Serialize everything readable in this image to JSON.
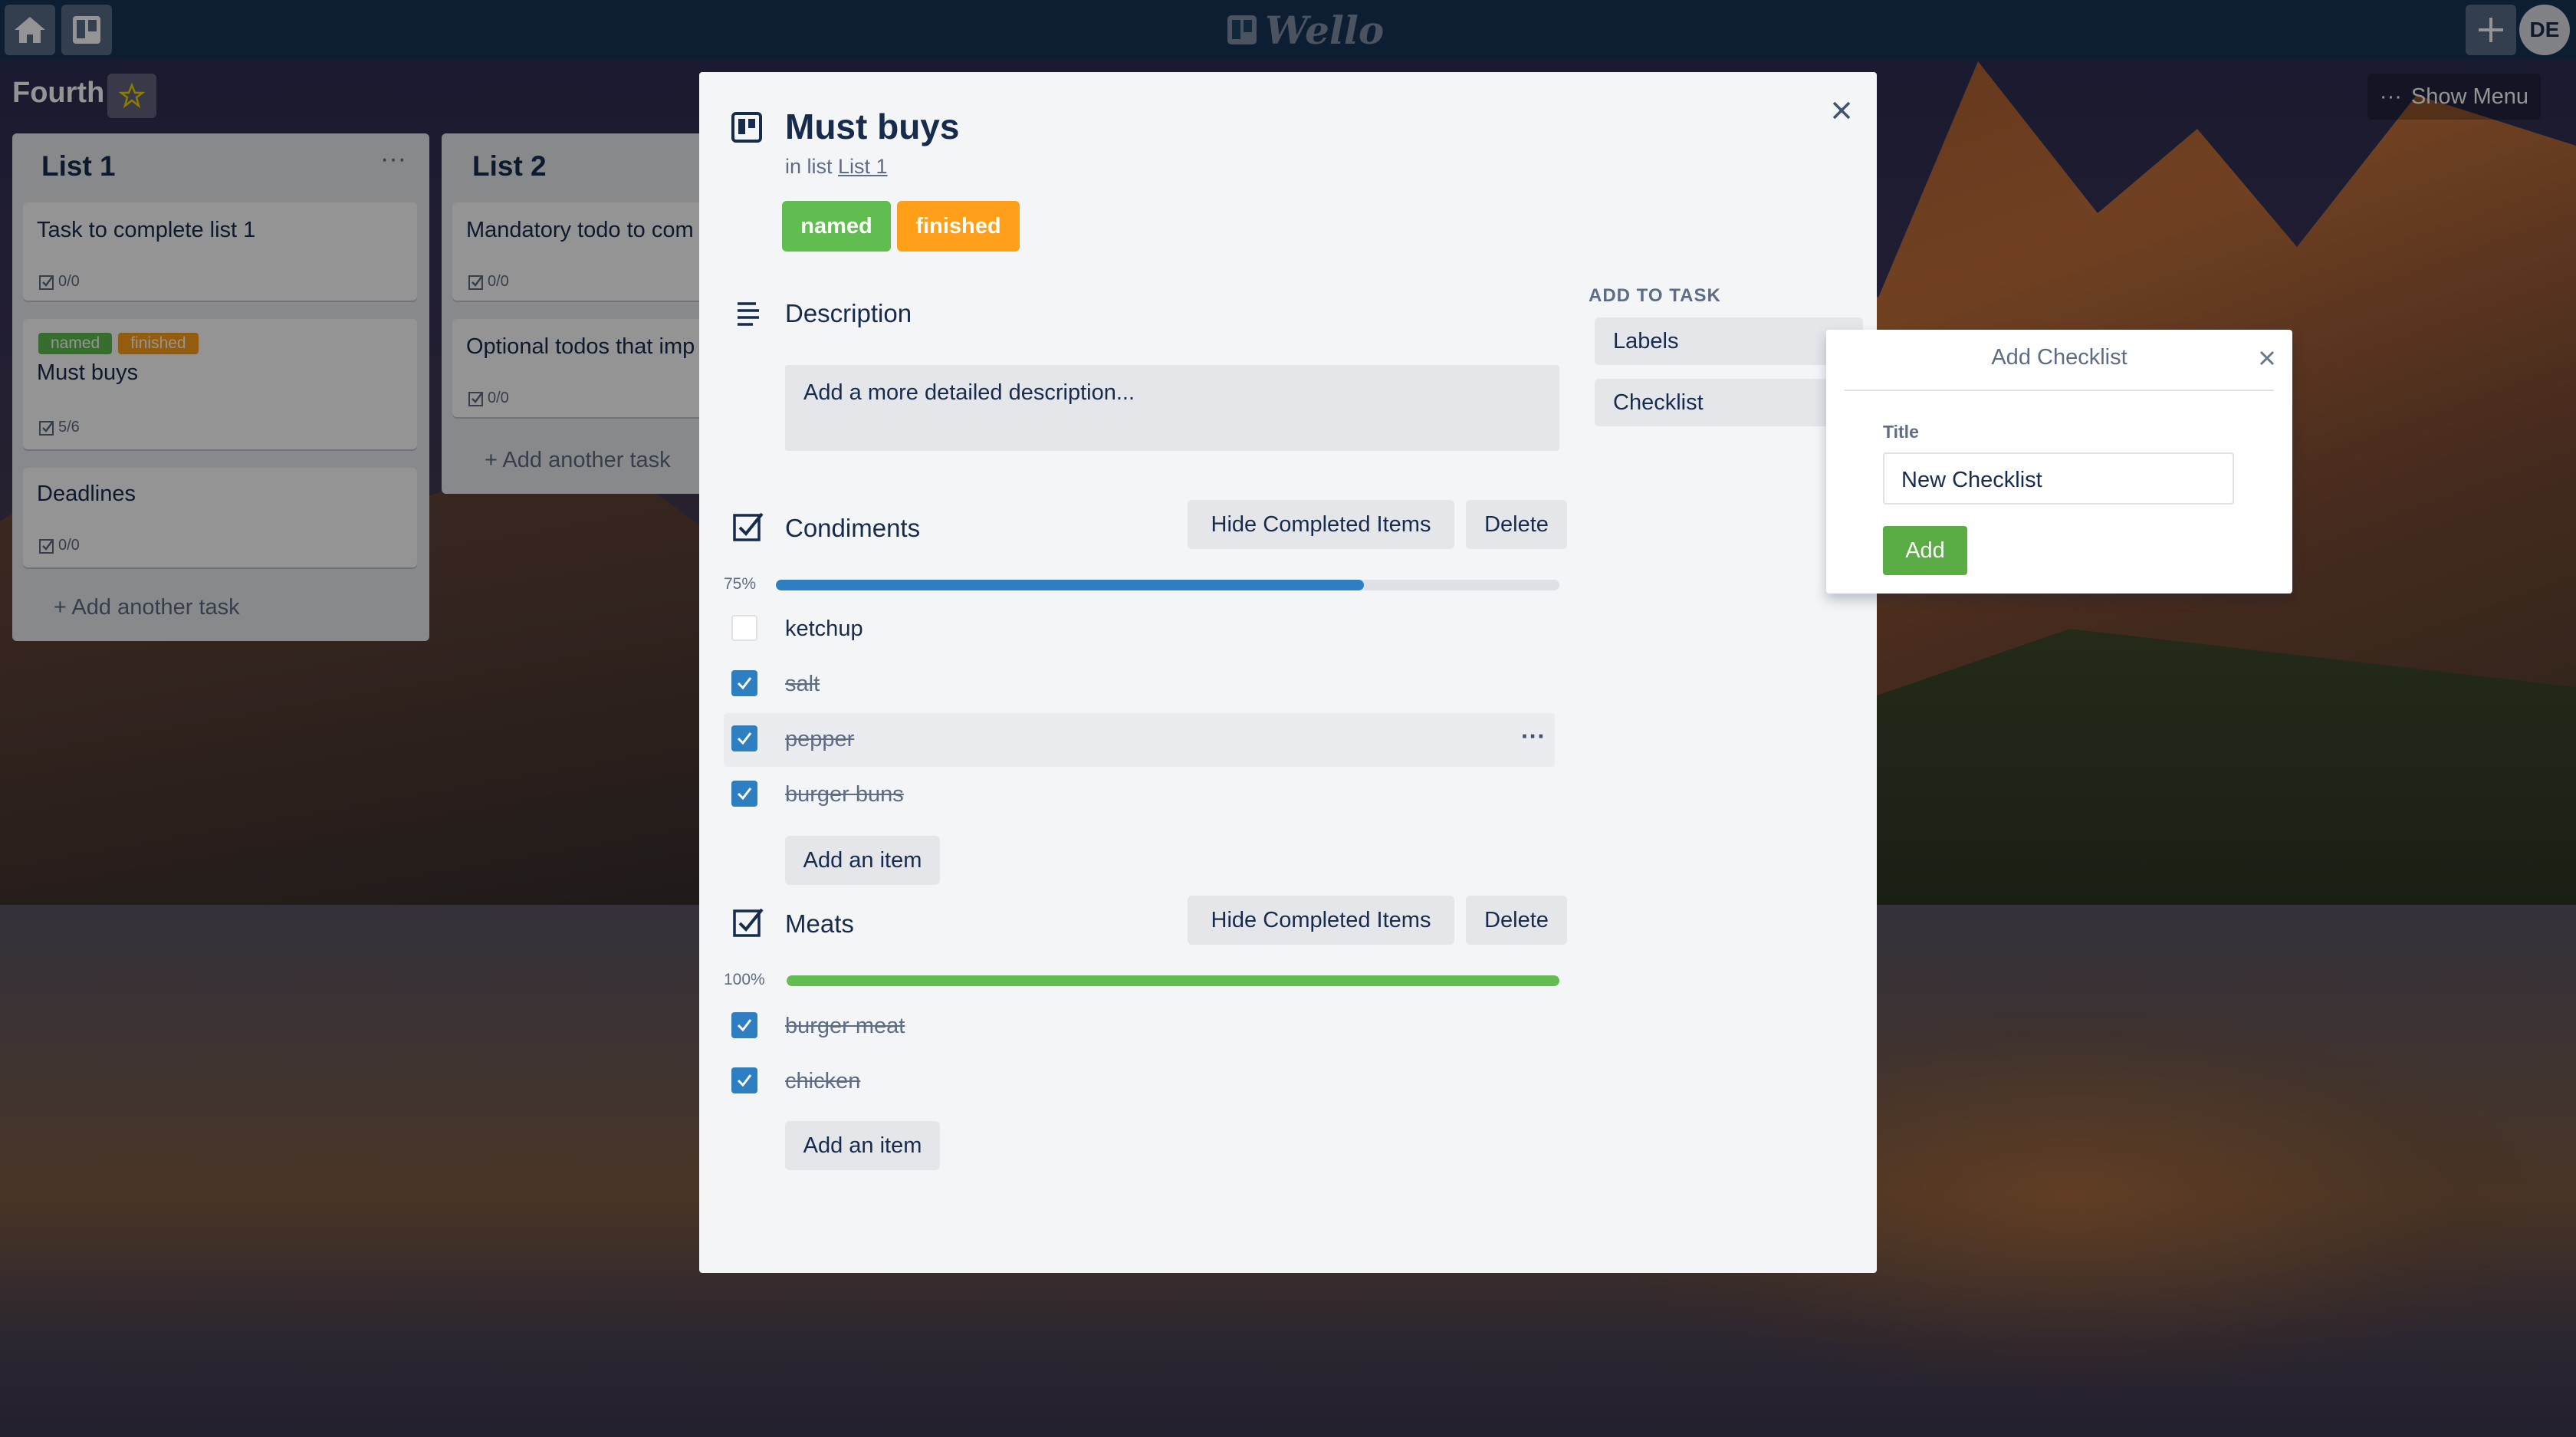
{
  "app": {
    "name": "Wello",
    "user_initials": "DE"
  },
  "board": {
    "title": "Fourth",
    "show_menu_label": "Show Menu"
  },
  "lists": [
    {
      "title": "List 1",
      "cards": [
        {
          "title": "Task to complete list 1",
          "checklist_badge": "0/0"
        },
        {
          "title": "Must buys",
          "labels": [
            "named",
            "finished"
          ],
          "checklist_badge": "5/6"
        },
        {
          "title": "Deadlines",
          "checklist_badge": "0/0"
        }
      ],
      "add_label": "Add another task"
    },
    {
      "title": "List 2",
      "cards": [
        {
          "title": "Mandatory todo to com",
          "checklist_badge": "0/0"
        },
        {
          "title": "Optional todos that imp",
          "checklist_badge": "0/0"
        }
      ],
      "add_label": "Add another task"
    }
  ],
  "modal": {
    "title": "Must buys",
    "in_list_prefix": "in list",
    "in_list_name": "List 1",
    "labels": [
      {
        "name": "named",
        "color": "#61bd4f"
      },
      {
        "name": "finished",
        "color": "#ff9f1a"
      }
    ],
    "description": {
      "heading": "Description",
      "placeholder": "Add a more detailed description..."
    },
    "add_to_task": {
      "heading": "ADD TO TASK",
      "items": [
        "Labels",
        "Checklist"
      ]
    },
    "checklists": [
      {
        "title": "Condiments",
        "hide_label": "Hide Completed Items",
        "delete_label": "Delete",
        "percent_label": "75%",
        "percent": 75,
        "bar_color": "#2d7fc1",
        "items": [
          {
            "text": "ketchup",
            "done": false
          },
          {
            "text": "salt",
            "done": true
          },
          {
            "text": "pepper",
            "done": true
          },
          {
            "text": "burger buns",
            "done": true
          }
        ],
        "add_item_label": "Add an item"
      },
      {
        "title": "Meats",
        "hide_label": "Hide Completed Items",
        "delete_label": "Delete",
        "percent_label": "100%",
        "percent": 100,
        "bar_color": "#61bd4f",
        "items": [
          {
            "text": "burger meat",
            "done": true
          },
          {
            "text": "chicken",
            "done": true
          }
        ],
        "add_item_label": "Add an item"
      }
    ]
  },
  "popover": {
    "title": "Add Checklist",
    "field_label": "Title",
    "field_value": "New Checklist",
    "submit_label": "Add"
  },
  "colors": {
    "accent": "#2d7fc1",
    "success": "#61bd4f",
    "warning": "#ff9f1a",
    "add_button": "#5aac44"
  }
}
